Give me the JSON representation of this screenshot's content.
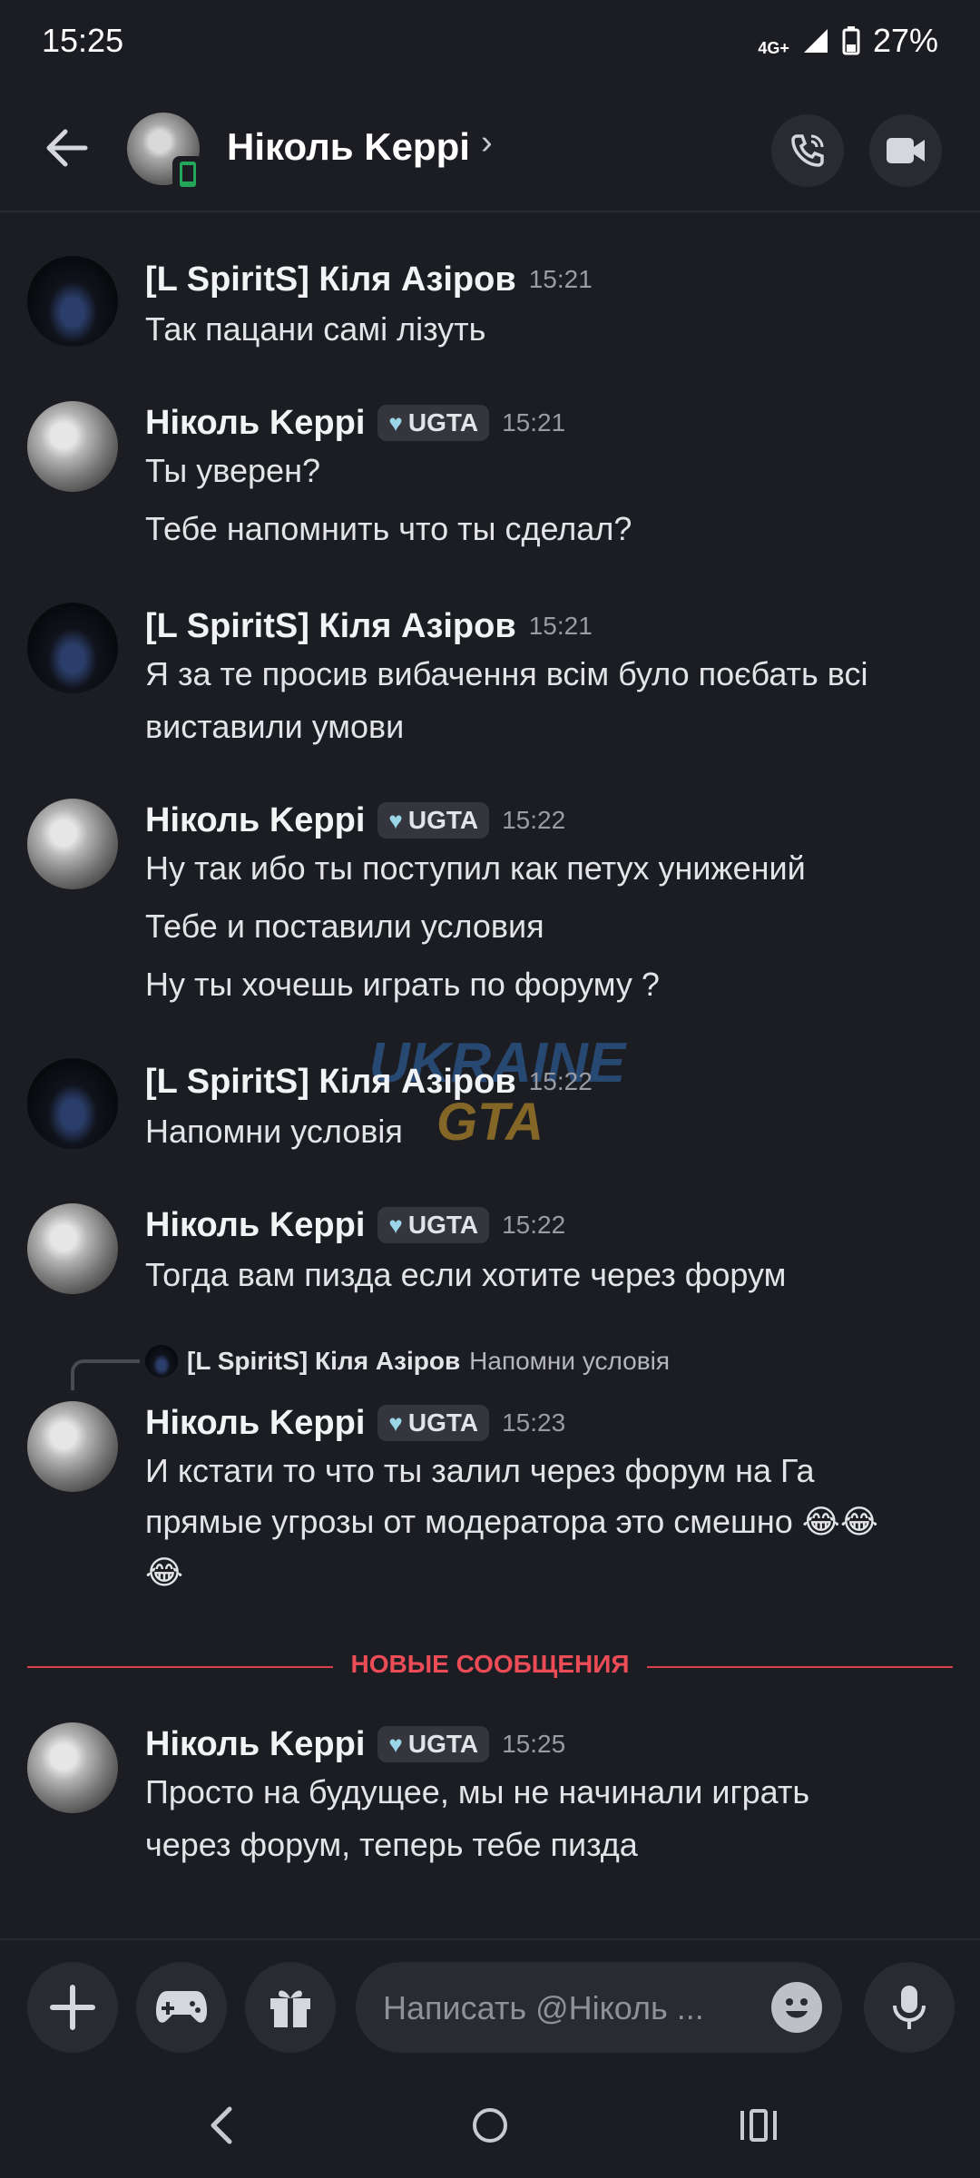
{
  "status_bar": {
    "time": "15:25",
    "network": "4G+",
    "battery": "27%"
  },
  "header": {
    "title": "Ніколь Keppi"
  },
  "messages": [
    {
      "author": "[L SpiritS] Кіля Азіров",
      "time": "15:21",
      "lines": [
        "Так пацани самі лізуть"
      ]
    },
    {
      "author": "Ніколь Keppi",
      "tag": "UGTA",
      "time": "15:21",
      "lines": [
        "Ты уверен?",
        "Тебе напомнить что ты сделал?"
      ]
    },
    {
      "author": "[L SpiritS] Кіля Азіров",
      "time": "15:21",
      "lines": [
        "Я за те просив вибачення всім було поєбать всі",
        "виставили умови"
      ]
    },
    {
      "author": "Ніколь Keppi",
      "tag": "UGTA",
      "time": "15:22",
      "lines": [
        "Ну так ибо ты поступил как петух унижений",
        "Тебе и поставили условия",
        "Ну ты хочешь играть по форуму ?"
      ]
    },
    {
      "author": "[L SpiritS] Кіля Азіров",
      "time": "15:22",
      "lines": [
        "Напомни условія"
      ]
    },
    {
      "author": "Ніколь Keppi",
      "tag": "UGTA",
      "time": "15:22",
      "lines": [
        "Тогда вам пизда если хотите через форум"
      ]
    },
    {
      "author": "Ніколь Keppi",
      "tag": "UGTA",
      "time": "15:23",
      "reply": {
        "author": "[L SpiritS] Кіля Азіров",
        "text": "Напомни условія"
      },
      "lines": [
        "И кстати то что ты залил через форум на Га",
        "прямые угрозы от модератора это смешно 😂😂",
        "😂"
      ]
    },
    {
      "author": "Ніколь Keppi",
      "tag": "UGTA",
      "time": "15:25",
      "lines": [
        "Просто на будущее, мы не начинали играть",
        "через форум, теперь тебе пизда"
      ]
    }
  ],
  "new_messages_divider": "НОВЫЕ СООБЩЕНИЯ",
  "watermark": {
    "line1": "UKRAINE",
    "line2": "GTA"
  },
  "composer": {
    "placeholder": "Написать @Ніколь ..."
  },
  "colors": {
    "background": "#1c1d22",
    "divider": "#ec4c56",
    "tag_bg": "#35363d"
  }
}
